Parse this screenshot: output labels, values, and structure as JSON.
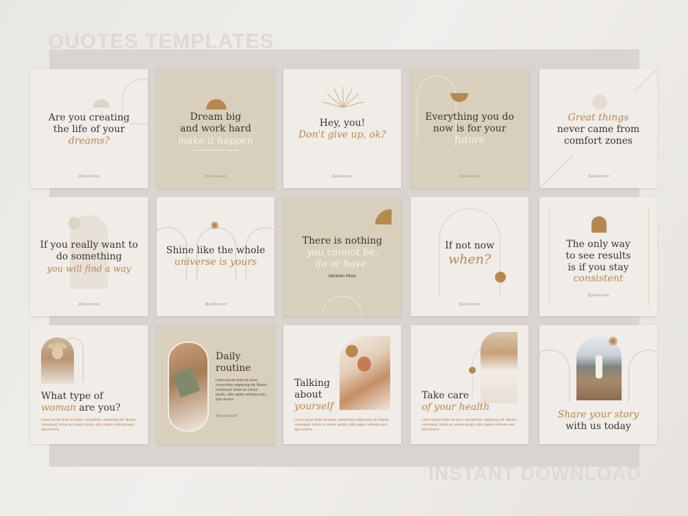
{
  "headings": {
    "top": "QUOTES TEMPLATES",
    "bottom": "INSTANT DOWNLOAD"
  },
  "colors": {
    "accent": "#b7894e",
    "light_card": "#f0ece8",
    "beige_card": "#d8cfbc",
    "text": "#3b3530"
  },
  "handle": "@youAccount",
  "lorem_short": "Lorem ipsum dolor sit amet, consectetur adipiscing elit. Mauris consequat, lectus ac ornare iaculis, odio sapien vehicula sem, quis viverra.",
  "lorem_block": "Lorem ipsum dolor sit amet, consectetur adipiscing elit. Mauris consequat, lectus ac ornare iaculis, odio sapien vehicula sem, quis viverra.",
  "cards": {
    "c1": {
      "l1": "Are you creating",
      "l2": "the life of your",
      "accent": "dreams?"
    },
    "c2": {
      "l1": "Dream big",
      "l2": "and work hard",
      "accent": "make it happen"
    },
    "c3": {
      "l1": "Hey, you!",
      "accent": "Don't give up, ok?"
    },
    "c4": {
      "l1": "Everything you do",
      "l2": "now is for your",
      "accent": "future"
    },
    "c5": {
      "accent": "Great things",
      "l1": "never came from",
      "l2": "comfort zones"
    },
    "c6": {
      "l1": "If you really want to",
      "l2": "do something",
      "accent": "you will find a way"
    },
    "c7": {
      "l1": "Shine like the whole",
      "accent": "universe is yours"
    },
    "c8": {
      "l1": "There is nothing",
      "a1": "you cannot be,",
      "a2": "do or have.",
      "author": "Abraham Hicks"
    },
    "c9": {
      "l1": "If not now",
      "accent": "when?"
    },
    "c10": {
      "l1": "The only way",
      "l2": "to see results",
      "l3": "is if you stay",
      "accent": "consistent"
    },
    "c11": {
      "l1": "What type of",
      "accent": "woman",
      "l2": "are you?"
    },
    "c12": {
      "l1": "Daily",
      "l2": "routine"
    },
    "c13": {
      "l1": "Talking",
      "l2": "about",
      "accent": "yourself"
    },
    "c14": {
      "l1": "Take care",
      "accent": "of your health"
    },
    "c15": {
      "accent": "Share your story",
      "l1": "with us today"
    }
  }
}
